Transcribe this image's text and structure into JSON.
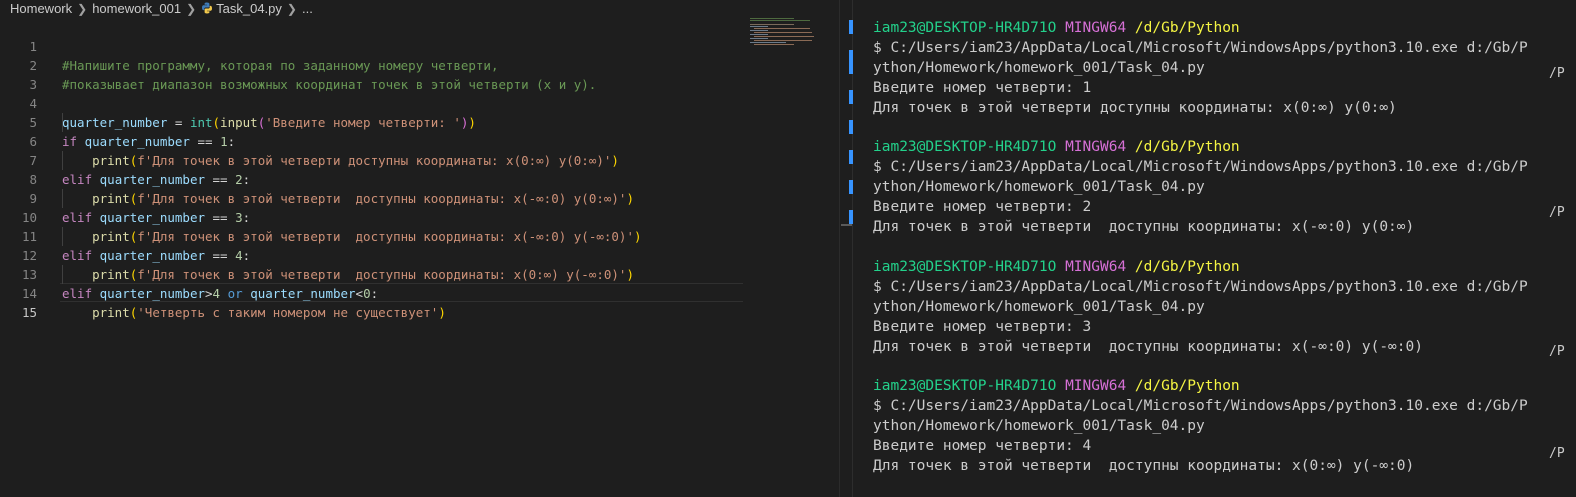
{
  "breadcrumb": {
    "items": [
      "Homework",
      "homework_001",
      "Task_04.py",
      "..."
    ]
  },
  "editor": {
    "line_numbers": [
      "1",
      "2",
      "3",
      "4",
      "5",
      "6",
      "7",
      "8",
      "9",
      "10",
      "11",
      "12",
      "13",
      "14",
      "15"
    ],
    "active_line": "15",
    "code": {
      "l1": "#Напишите программу, которая по заданному номеру четверти,",
      "l2": "#показывает диапазон возможных координат точек в этой четверти (x и y).",
      "var": "quarter_number",
      "int": "int",
      "input": "input",
      "prompt": "'Введите номер четверти: '",
      "if": "if",
      "elif": "elif",
      "or": "or",
      "print": "print",
      "n1": "1",
      "n2": "2",
      "n3": "3",
      "n4": "4",
      "n0": "0",
      "s1": "f'Для точек в этой четверти доступны координаты: x(0:∞) y(0:∞)'",
      "s2": "f'Для точек в этой четверти  доступны координаты: x(-∞:0) y(0:∞)'",
      "s3": "f'Для точек в этой четверти  доступны координаты: x(-∞:0) y(-∞:0)'",
      "s4": "f'Для точек в этой четверти  доступны координаты: x(0:∞) y(-∞:0)'",
      "s5": "'Четверть с таким номером не существует'"
    }
  },
  "terminal": {
    "runs": [
      {
        "user": "iam23@DESKTOP-HR4D71O",
        "env": "MINGW64",
        "path": "/d/Gb/Python",
        "cmd1": "$ C:/Users/iam23/AppData/Local/Microsoft/WindowsApps/python3.10.exe d:/Gb/P",
        "cmd2": "ython/Homework/homework_001/Task_04.py",
        "prompt": "Введите номер четверти: 1",
        "result": "Для точек в этой четверти доступны координаты: x(0:∞) y(0:∞)"
      },
      {
        "user": "iam23@DESKTOP-HR4D71O",
        "env": "MINGW64",
        "path": "/d/Gb/Python",
        "cmd1": "$ C:/Users/iam23/AppData/Local/Microsoft/WindowsApps/python3.10.exe d:/Gb/P",
        "cmd2": "ython/Homework/homework_001/Task_04.py",
        "prompt": "Введите номер четверти: 2",
        "result": "Для точек в этой четверти  доступны координаты: x(-∞:0) y(0:∞)"
      },
      {
        "user": "iam23@DESKTOP-HR4D71O",
        "env": "MINGW64",
        "path": "/d/Gb/Python",
        "cmd1": "$ C:/Users/iam23/AppData/Local/Microsoft/WindowsApps/python3.10.exe d:/Gb/P",
        "cmd2": "ython/Homework/homework_001/Task_04.py",
        "prompt": "Введите номер четверти: 3",
        "result": "Для точек в этой четверти  доступны координаты: x(-∞:0) y(-∞:0)"
      },
      {
        "user": "iam23@DESKTOP-HR4D71O",
        "env": "MINGW64",
        "path": "/d/Gb/Python",
        "cmd1": "$ C:/Users/iam23/AppData/Local/Microsoft/WindowsApps/python3.10.exe d:/Gb/P",
        "cmd2": "ython/Homework/homework_001/Task_04.py",
        "prompt": "Введите номер четверти: 4",
        "result": "Для точек в этой четверти  доступны координаты: x(0:∞) y(-∞:0)"
      }
    ],
    "wrap_marker": "/P"
  },
  "colors": {
    "accent_blue": "#3794ff",
    "terminal_user": "#23d18b",
    "terminal_env": "#d670d6",
    "terminal_path": "#f5f543"
  },
  "icons": {
    "breadcrumb_separator": "chevron-right-icon",
    "file_type": "python-file-icon"
  }
}
